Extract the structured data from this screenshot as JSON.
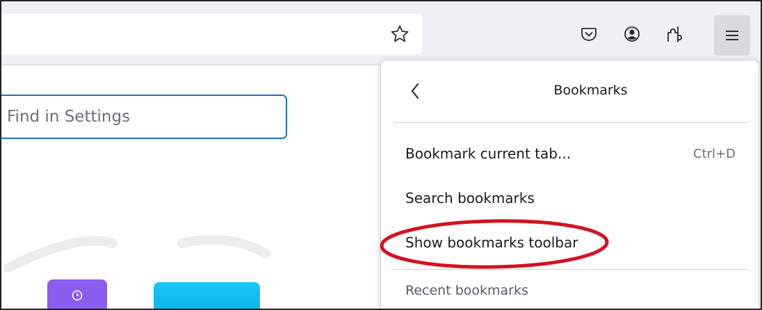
{
  "search": {
    "placeholder": "Find in Settings",
    "value": ""
  },
  "toolbar": {
    "icons": [
      "star-icon",
      "pocket-icon",
      "account-icon",
      "extensions-icon",
      "menu-icon"
    ]
  },
  "panel": {
    "title": "Bookmarks",
    "items": [
      {
        "label": "Bookmark current tab...",
        "shortcut": "Ctrl+D"
      },
      {
        "label": "Search bookmarks",
        "shortcut": ""
      },
      {
        "label": "Show bookmarks toolbar",
        "shortcut": ""
      }
    ],
    "section_label": "Recent bookmarks"
  },
  "colors": {
    "accent": "#1f6fd0",
    "highlight_circle": "#d4121f",
    "tile_purple": "#8b5cf0",
    "tile_cyan": "#19c6f5"
  }
}
